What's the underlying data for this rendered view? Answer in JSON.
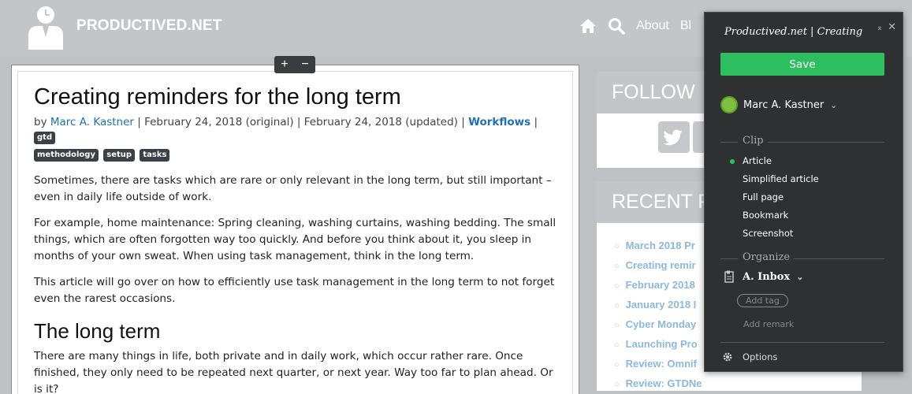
{
  "header": {
    "site_name": "PRODUCTIVED.NET",
    "nav": {
      "about": "About",
      "blog": "Bl"
    },
    "icons": {
      "home": "home-icon",
      "search": "search-icon",
      "logo": "person-with-clock-logo"
    },
    "colors": {
      "bar": "#c4c5c8"
    }
  },
  "zoom": {
    "plus": "+",
    "minus": "−"
  },
  "article": {
    "title": "Creating reminders for the long term",
    "meta": {
      "by": "by ",
      "author": "Marc A. Kastner",
      "dates": " | February 24, 2018 (original) | February 24, 2018 (updated) | ",
      "category": "Workflows",
      "sep": " | "
    },
    "tags": [
      "gtd",
      "methodology",
      "setup",
      "tasks"
    ],
    "paragraphs": [
      "Sometimes, there are tasks which are rare or only relevant in the long term, but still important – even in daily life outside of work.",
      "For example, home maintenance: Spring cleaning, washing curtains, washing bedding. The small things, which are often forgotten way too quickly. And before you think about it, you sleep in months of your own sweat. When using task management, think in the long term.",
      "This article will go over on how to efficiently use task management in the long term to not forget even the rarest occasions."
    ],
    "subheading": "The long term",
    "paragraph_after": "There are many things in life, both private and in daily work, which occur rather rare. Once finished, they only need to be repeated next quarter, or next year. Way too far to plan ahead. Or is it?"
  },
  "sidebar": {
    "follow_heading": "FOLLOW",
    "recent_heading": "RECENT P",
    "recent_posts": [
      "March 2018 Pr",
      "Creating remir",
      "February 2018",
      "January 2018 I",
      "Cyber Monday",
      "Launching Pro",
      "Review: Omnif",
      "Review: GTDNe"
    ]
  },
  "clipper": {
    "title": "Productived.net | Creating",
    "controls": "⌅ ✕",
    "save_label": "Save",
    "account_name": "Marc A. Kastner",
    "clip_section": "Clip",
    "clip_options": [
      "Article",
      "Simplified article",
      "Full page",
      "Bookmark",
      "Screenshot"
    ],
    "selected_option": "Article",
    "organize_section": "Organize",
    "notebook": "A. Inbox",
    "add_tag_placeholder": "Add tag",
    "add_remark_placeholder": "Add remark",
    "options_label": "Options",
    "colors": {
      "panel": "#2f3032",
      "accent": "#2dbe60"
    }
  }
}
